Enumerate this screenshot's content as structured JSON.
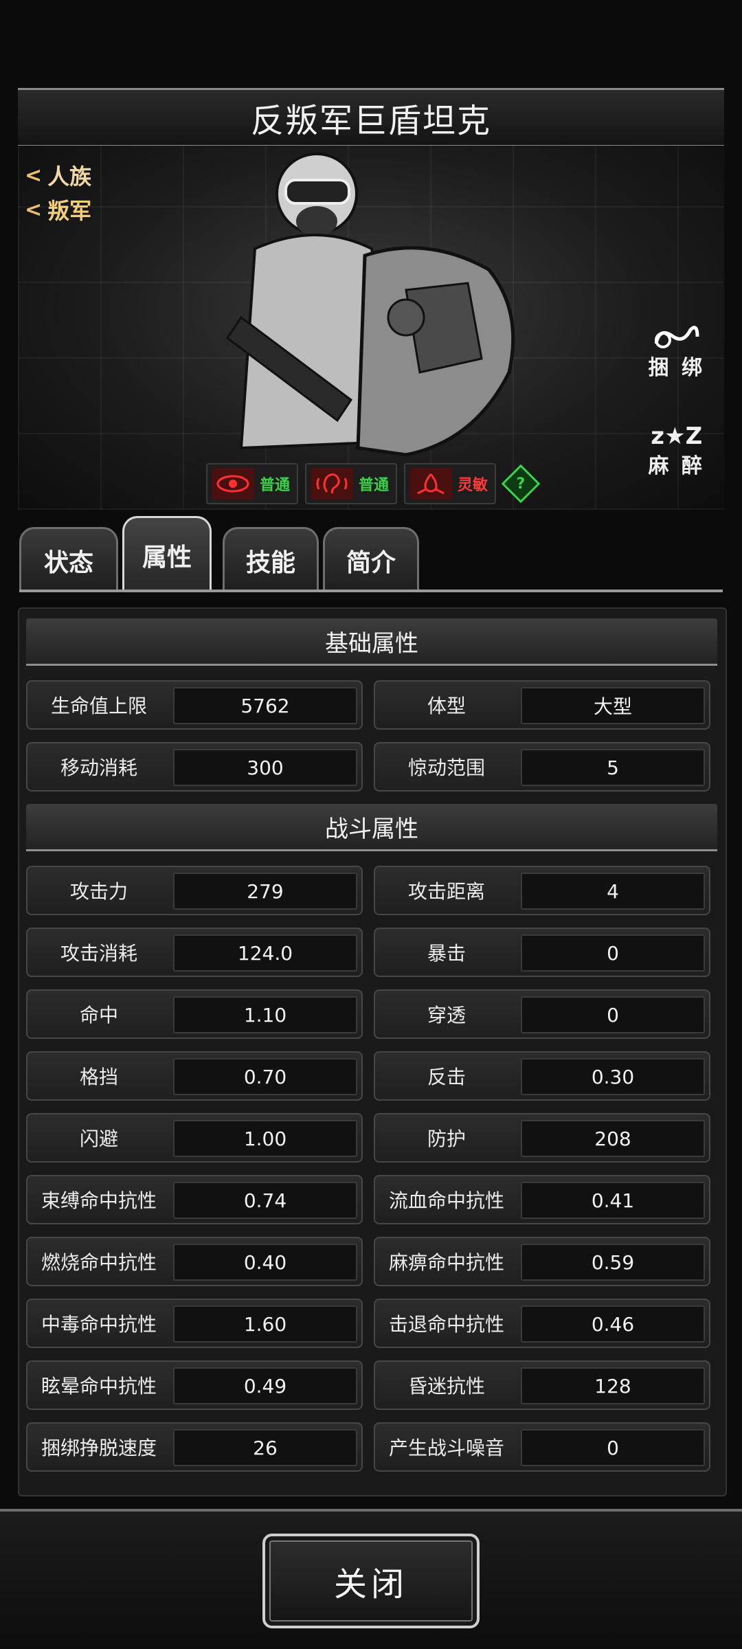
{
  "title": "反叛军巨盾坦克",
  "factions": [
    "人族",
    "叛军"
  ],
  "side_actions": {
    "bind": "捆 绑",
    "sleep": "麻 醉"
  },
  "senses": [
    {
      "icon": "eye-icon",
      "text": "普通",
      "color": "#39d24a"
    },
    {
      "icon": "ear-icon",
      "text": "普通",
      "color": "#39d24a"
    },
    {
      "icon": "smell-icon",
      "text": "灵敏",
      "color": "#ff3a3a"
    }
  ],
  "help": "?",
  "tabs": [
    "状态",
    "属性",
    "技能",
    "简介"
  ],
  "active_tab": "属性",
  "sections": {
    "basic": {
      "title": "基础属性",
      "rows": [
        [
          {
            "label": "生命值上限",
            "value": "5762"
          },
          {
            "label": "体型",
            "value": "大型"
          }
        ],
        [
          {
            "label": "移动消耗",
            "value": "300"
          },
          {
            "label": "惊动范围",
            "value": "5"
          }
        ]
      ]
    },
    "combat": {
      "title": "战斗属性",
      "rows": [
        [
          {
            "label": "攻击力",
            "value": "279"
          },
          {
            "label": "攻击距离",
            "value": "4"
          }
        ],
        [
          {
            "label": "攻击消耗",
            "value": "124.0"
          },
          {
            "label": "暴击",
            "value": "0"
          }
        ],
        [
          {
            "label": "命中",
            "value": "1.10"
          },
          {
            "label": "穿透",
            "value": "0"
          }
        ],
        [
          {
            "label": "格挡",
            "value": "0.70"
          },
          {
            "label": "反击",
            "value": "0.30"
          }
        ],
        [
          {
            "label": "闪避",
            "value": "1.00"
          },
          {
            "label": "防护",
            "value": "208"
          }
        ],
        [
          {
            "label": "束缚命中抗性",
            "value": "0.74"
          },
          {
            "label": "流血命中抗性",
            "value": "0.41"
          }
        ],
        [
          {
            "label": "燃烧命中抗性",
            "value": "0.40"
          },
          {
            "label": "麻痹命中抗性",
            "value": "0.59"
          }
        ],
        [
          {
            "label": "中毒命中抗性",
            "value": "1.60"
          },
          {
            "label": "击退命中抗性",
            "value": "0.46"
          }
        ],
        [
          {
            "label": "眩晕命中抗性",
            "value": "0.49"
          },
          {
            "label": "昏迷抗性",
            "value": "128"
          }
        ],
        [
          {
            "label": "捆绑挣脱速度",
            "value": "26"
          },
          {
            "label": "产生战斗噪音",
            "value": "0"
          }
        ]
      ]
    }
  },
  "close_label": "关闭"
}
